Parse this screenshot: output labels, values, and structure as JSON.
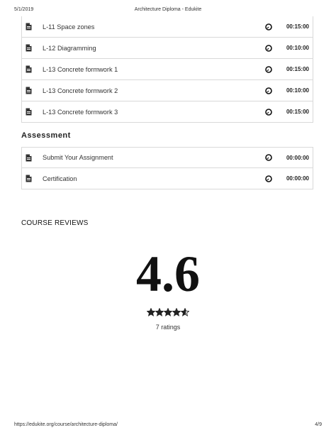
{
  "header": {
    "date": "5/1/2019",
    "title": "Architecture Diploma - Edukite"
  },
  "lessons": [
    {
      "label": "L-11 Space zones",
      "duration": "00:15:00"
    },
    {
      "label": "L-12 Diagramming",
      "duration": "00:10:00"
    },
    {
      "label": "L-13 Concrete formwork 1",
      "duration": "00:15:00"
    },
    {
      "label": "L-13 Concrete formwork 2",
      "duration": "00:10:00"
    },
    {
      "label": "L-13 Concrete formwork 3",
      "duration": "00:15:00"
    }
  ],
  "assessment": {
    "title": "Assessment",
    "items": [
      {
        "label": "Submit Your Assignment",
        "duration": "00:00:00"
      },
      {
        "label": "Certification",
        "duration": "00:00:00"
      }
    ]
  },
  "reviews": {
    "title": "COURSE REVIEWS",
    "rating": "4.6",
    "stars_value": 4.6,
    "stars_max": 5,
    "count_text": "7 ratings"
  },
  "footer": {
    "url": "https://edukite.org/course/architecture-diploma/",
    "page": "4/9"
  },
  "icons": {
    "row_icon": "document-icon",
    "duration_icon": "clock-icon"
  }
}
